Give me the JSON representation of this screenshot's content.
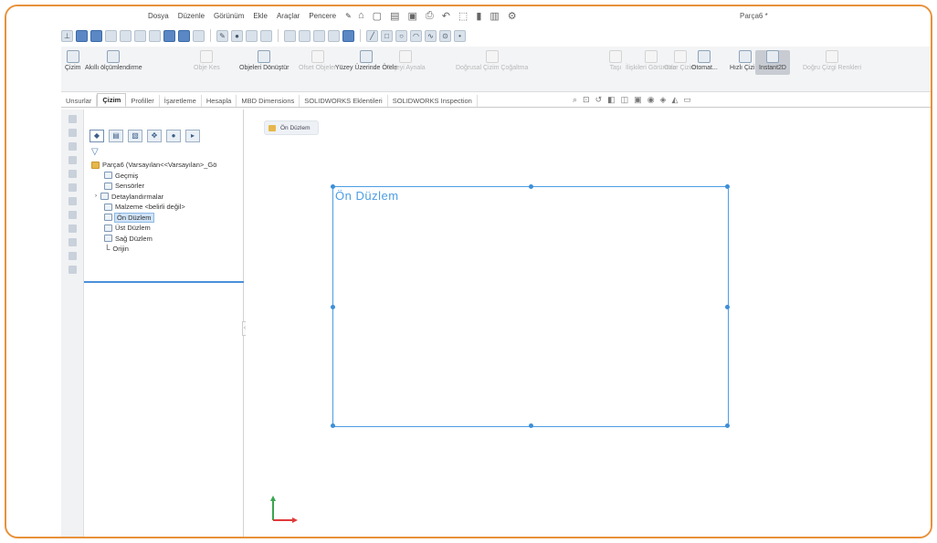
{
  "app": {
    "menu": [
      "Dosya",
      "Düzenle",
      "Görünüm",
      "Ekle",
      "Araçlar",
      "Pencere"
    ],
    "document_title": "Parça6 *",
    "accent_color": "#e8913a",
    "selection_color": "#4d9ee3"
  },
  "ribbon": {
    "items": [
      {
        "label": "Çizim",
        "icon": "sketch-icon"
      },
      {
        "label": "Akıllı ölçümlendirme",
        "icon": "smart-dimension-icon"
      },
      {
        "label": "Obje Kes",
        "icon": "trim-icon"
      },
      {
        "label": "Objeleri Dönüştür",
        "icon": "convert-icon"
      },
      {
        "label": "Ofset Objeler",
        "icon": "offset-icon"
      },
      {
        "label": "Yüzey Üzerinde Ötele",
        "icon": "offset-surface-icon"
      },
      {
        "label": "Objeyi Aynala",
        "icon": "mirror-icon"
      },
      {
        "label": "Doğrusal Çizim Çoğaltma",
        "icon": "linear-pattern-icon"
      },
      {
        "label": "Taşı",
        "icon": "move-icon"
      },
      {
        "label": "İlişkileri Görüntüle",
        "icon": "relations-icon"
      },
      {
        "label": "Onar Çizim",
        "icon": "repair-icon"
      },
      {
        "label": "Otomat...",
        "icon": "auto-icon"
      },
      {
        "label": "Hızlı Çizim",
        "icon": "rapid-sketch-icon"
      },
      {
        "label": "Instant2D",
        "icon": "instant2d-icon"
      },
      {
        "label": "Doğru Çizgi Renkleri",
        "icon": "color-icon"
      }
    ]
  },
  "tabs": [
    "Unsurlar",
    "Çizim",
    "Profiller",
    "İşaretleme",
    "Hesapla",
    "MBD Dimensions",
    "SOLIDWORKS Eklentileri",
    "SOLIDWORKS Inspection"
  ],
  "active_tab": "Çizim",
  "feature_tree": {
    "root": "Parça6 (Varsayılan<<Varsayılan>_Gö",
    "items": [
      {
        "label": "Geçmiş",
        "icon": "history-icon"
      },
      {
        "label": "Sensörler",
        "icon": "sensors-icon"
      },
      {
        "label": "Detaylandırmalar",
        "icon": "annotations-icon"
      },
      {
        "label": "Malzeme <belirli değil>",
        "icon": "material-icon"
      },
      {
        "label": "Ön Düzlem",
        "icon": "plane-icon",
        "selected": true
      },
      {
        "label": "Üst Düzlem",
        "icon": "plane-icon"
      },
      {
        "label": "Sağ Düzlem",
        "icon": "plane-icon"
      },
      {
        "label": "Orijin",
        "icon": "origin-icon"
      }
    ]
  },
  "canvas": {
    "breadcrumb": "Ön Düzlem",
    "plane_label": "Ön Düzlem"
  }
}
